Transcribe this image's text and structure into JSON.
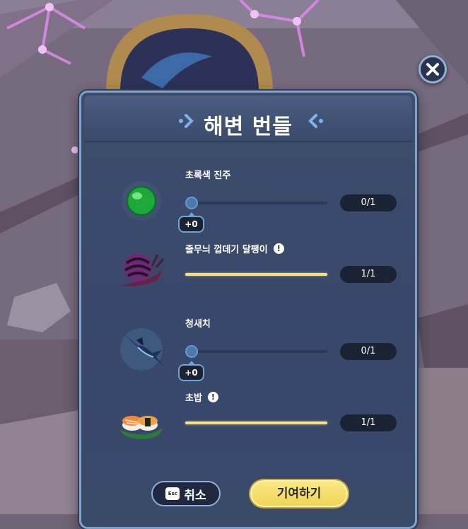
{
  "panel": {
    "title": "해변 번들"
  },
  "items": [
    {
      "name": "초록색 진주",
      "icon": "green-pearl-icon",
      "count": "0/1",
      "progress": 0,
      "delta": "+0",
      "warning": false
    },
    {
      "name": "줄무늬 껍데기 달팽이",
      "icon": "striped-shell-snail-icon",
      "count": "1/1",
      "progress": 1,
      "warning": true,
      "warning_symbol": "!"
    },
    {
      "name": "청새치",
      "icon": "marlin-icon",
      "count": "0/1",
      "progress": 0,
      "delta": "+0",
      "warning": false
    },
    {
      "name": "초밥",
      "icon": "sushi-icon",
      "count": "1/1",
      "progress": 1,
      "warning": true,
      "warning_symbol": "!"
    }
  ],
  "buttons": {
    "cancel_label": "취소",
    "esc_key_label": "Esc",
    "contribute_label": "기여하기"
  },
  "colors": {
    "panel_bg": "#3a4a69",
    "panel_border": "#7fa3c9",
    "progress_full": "#f3e08a",
    "contribute_button": "#f1d55a",
    "count_pill_bg": "#1b2234"
  }
}
